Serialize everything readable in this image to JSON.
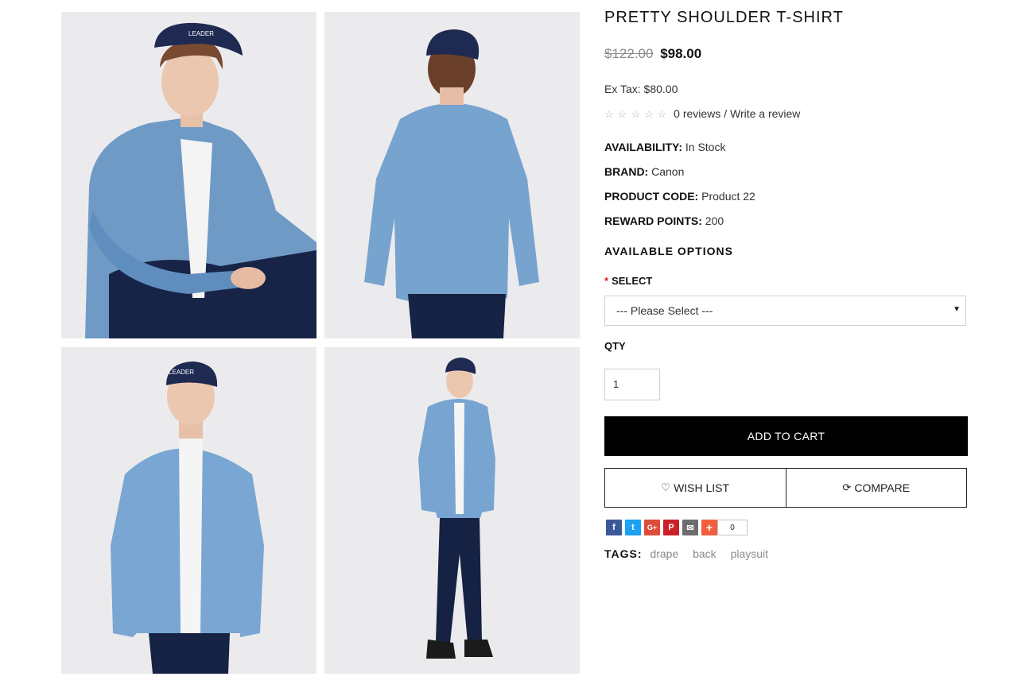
{
  "gallery": {
    "images": [
      {
        "name": "model-seated-front"
      },
      {
        "name": "model-back-view"
      },
      {
        "name": "model-front-half"
      },
      {
        "name": "model-full-length"
      }
    ],
    "cap_text": "LEADER"
  },
  "product": {
    "title": "PRETTY SHOULDER T-SHIRT",
    "old_price": "$122.00",
    "price": "$98.00",
    "ex_tax": "Ex Tax: $80.00",
    "reviews": "0 reviews",
    "review_separator": " / ",
    "write_review": "Write a review",
    "availability_label": "AVAILABILITY:",
    "availability_value": "In Stock",
    "brand_label": "BRAND:",
    "brand_value": "Canon",
    "code_label": "PRODUCT CODE:",
    "code_value": "Product 22",
    "points_label": "REWARD POINTS:",
    "points_value": "200",
    "rating_stars": 0
  },
  "options": {
    "heading": "AVAILABLE OPTIONS",
    "required_mark": "*",
    "select_label": "SELECT",
    "select_value": "--- Please Select ---",
    "qty_label": "QTY",
    "qty_value": "1"
  },
  "actions": {
    "add_to_cart": "ADD TO CART",
    "wish_list": "WISH LIST",
    "compare": "COMPARE"
  },
  "share": {
    "count": "0",
    "colors": {
      "facebook": "#3b5998",
      "twitter": "#1da1f2",
      "google": "#dd4b39",
      "pinterest": "#cb2027",
      "email": "#6d6d6d",
      "more": "#f0603f"
    }
  },
  "tags": {
    "label": "TAGS:",
    "items": [
      "drape",
      "back",
      "playsuit"
    ]
  }
}
